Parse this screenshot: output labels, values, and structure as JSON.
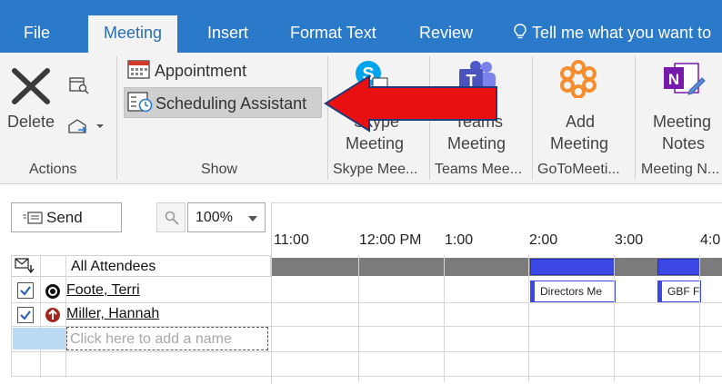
{
  "tabs": [
    {
      "label": "File",
      "active": false
    },
    {
      "label": "Meeting",
      "active": true
    },
    {
      "label": "Insert",
      "active": false
    },
    {
      "label": "Format Text",
      "active": false
    },
    {
      "label": "Review",
      "active": false
    }
  ],
  "tell_me": "Tell me what you want to",
  "ribbon": {
    "actions": {
      "delete_label": "Delete",
      "group_label": "Actions"
    },
    "show": {
      "appointment_label": "Appointment",
      "scheduling_label": "Scheduling Assistant",
      "group_label": "Show"
    },
    "skype": {
      "line1": "Skype",
      "line2": "Meeting",
      "group_label": "Skype Mee..."
    },
    "teams": {
      "line1": "Teams",
      "line2": "Meeting",
      "group_label": "Teams Mee..."
    },
    "gotomeeting": {
      "line1": "Add",
      "line2": "Meeting",
      "group_label": "GoToMeeti..."
    },
    "notes": {
      "line1": "Meeting",
      "line2": "Notes",
      "group_label": "Meeting N..."
    }
  },
  "toolbar": {
    "send_label": "Send",
    "zoom_value": "100%"
  },
  "timeline": {
    "times": [
      "11:00",
      "12:00 PM",
      "1:00",
      "2:00",
      "3:00",
      "4:0"
    ]
  },
  "attendees": {
    "header": "All Attendees",
    "list": [
      {
        "name": "Foote, Terri",
        "checked": true
      },
      {
        "name": "Miller, Hannah",
        "checked": true
      }
    ],
    "add_placeholder": "Click here to add a name"
  },
  "events": [
    {
      "title": "Directors Me"
    },
    {
      "title": "GBF F"
    }
  ],
  "colors": {
    "accent": "#2b79c9",
    "busy": "#3b48e6",
    "arrow": "#e81010"
  }
}
